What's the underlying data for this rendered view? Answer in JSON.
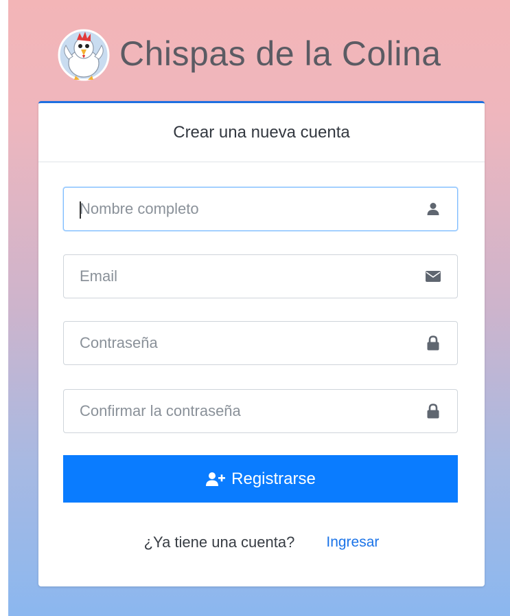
{
  "brand": {
    "title": "Chispas de la Colina",
    "logo_icon": "rooster-mascot-icon"
  },
  "card": {
    "header": "Crear una nueva cuenta",
    "accent_color": "#1e6fe0"
  },
  "form": {
    "full_name": {
      "placeholder": "Nombre completo",
      "value": "",
      "icon": "user-icon",
      "focused": true
    },
    "email": {
      "placeholder": "Email",
      "value": "",
      "icon": "envelope-icon"
    },
    "password": {
      "placeholder": "Contraseña",
      "value": "",
      "icon": "lock-icon"
    },
    "confirm_password": {
      "placeholder": "Confirmar la contraseña",
      "value": "",
      "icon": "lock-icon"
    },
    "submit": {
      "label": "Registrarse",
      "icon": "user-plus-icon",
      "color": "#0a7cff"
    }
  },
  "footer": {
    "question": "¿Ya tiene una cuenta?",
    "login_link": "Ingresar"
  }
}
